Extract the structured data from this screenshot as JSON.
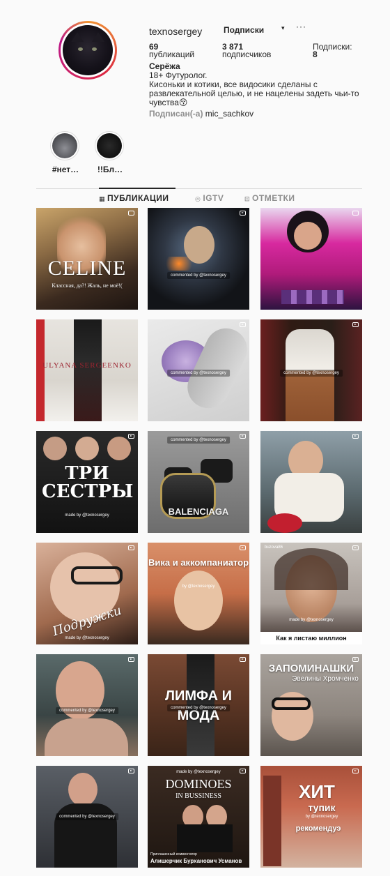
{
  "profile": {
    "username": "texnosergey",
    "follow_label": "Подписки",
    "dropdown_glyph": "▾",
    "more_glyph": "···",
    "stats": {
      "posts_count": "69",
      "posts_label": "публикаций",
      "followers_count": "3 871",
      "followers_label": "подписчиков",
      "following_label": "Подписки:",
      "following_count": "8"
    },
    "name": "Серёжа",
    "bio_line1": "18+ Футуролог.",
    "bio_line2": "Кисоньки и котики, все видосики сделаны с развлекательной целью, и не нацелены задеть чьи-то чувства😚",
    "followed_label": "Подписан(-а)",
    "followed_user": "mic_sachkov"
  },
  "highlights": [
    {
      "label": "#нет…"
    },
    {
      "label": "!!Бл…"
    }
  ],
  "tabs": [
    {
      "label": "ПУБЛИКАЦИИ",
      "icon": "grid-icon"
    },
    {
      "label": "IGTV",
      "icon": "igtv-icon"
    },
    {
      "label": "ОТМЕТКИ",
      "icon": "tag-icon"
    }
  ],
  "posts": [
    {
      "caption": "CELINE",
      "subcaption": "Классная, да?! Жаль, не моё!(",
      "badge": "carousel"
    },
    {
      "stamp": "commented by @texnosergey",
      "badge": "video"
    },
    {
      "badge": "carousel"
    },
    {
      "caption": "ULYANA SERGEENKO",
      "badge": "none"
    },
    {
      "stamp": "commented by @texnosergey",
      "badge": "video"
    },
    {
      "stamp": "commented by @texnosergey",
      "badge": "video"
    },
    {
      "caption": "ТРИ СЕСТРЫ",
      "small": "made by @texnosergey",
      "badge": "video"
    },
    {
      "stamp": "commented by @texnosergey",
      "caption": "BALENCIAGA",
      "badge": "video"
    },
    {
      "badge": "video"
    },
    {
      "small": "made by @texnosergey",
      "script": "Подружки",
      "badge": "video"
    },
    {
      "caption": "Вика и аккомпаниатор",
      "small": "by @texnosergey",
      "badge": "video"
    },
    {
      "topname": "buzova86",
      "small": "made by @texnosergey",
      "banner": "Как я листаю миллион",
      "badge": "video"
    },
    {
      "stamp": "commented by @texnosergey",
      "badge": "video"
    },
    {
      "caption": "ЛИМФА И МОДА",
      "stamp": "commented by @texnosergey",
      "badge": "video"
    },
    {
      "caption": "ЗАПОМИНАШКИ",
      "subcaption": "Эвелины Хромченко",
      "badge": "video"
    },
    {
      "stamp": "commented by @texnosergey",
      "badge": "video"
    },
    {
      "small": "made by @texnosergey",
      "caption": "DOMINOES",
      "subcaption": "IN BUSSINESS",
      "footer": "Приглашенный комментатор",
      "footer2": "Алишерчик Бурханович Усманов",
      "badge": "video"
    },
    {
      "caption": "ХИТ",
      "subcaption": "тупик",
      "small": "by @texnosergey",
      "caption2": "рекомендуэ",
      "badge": "video"
    }
  ]
}
